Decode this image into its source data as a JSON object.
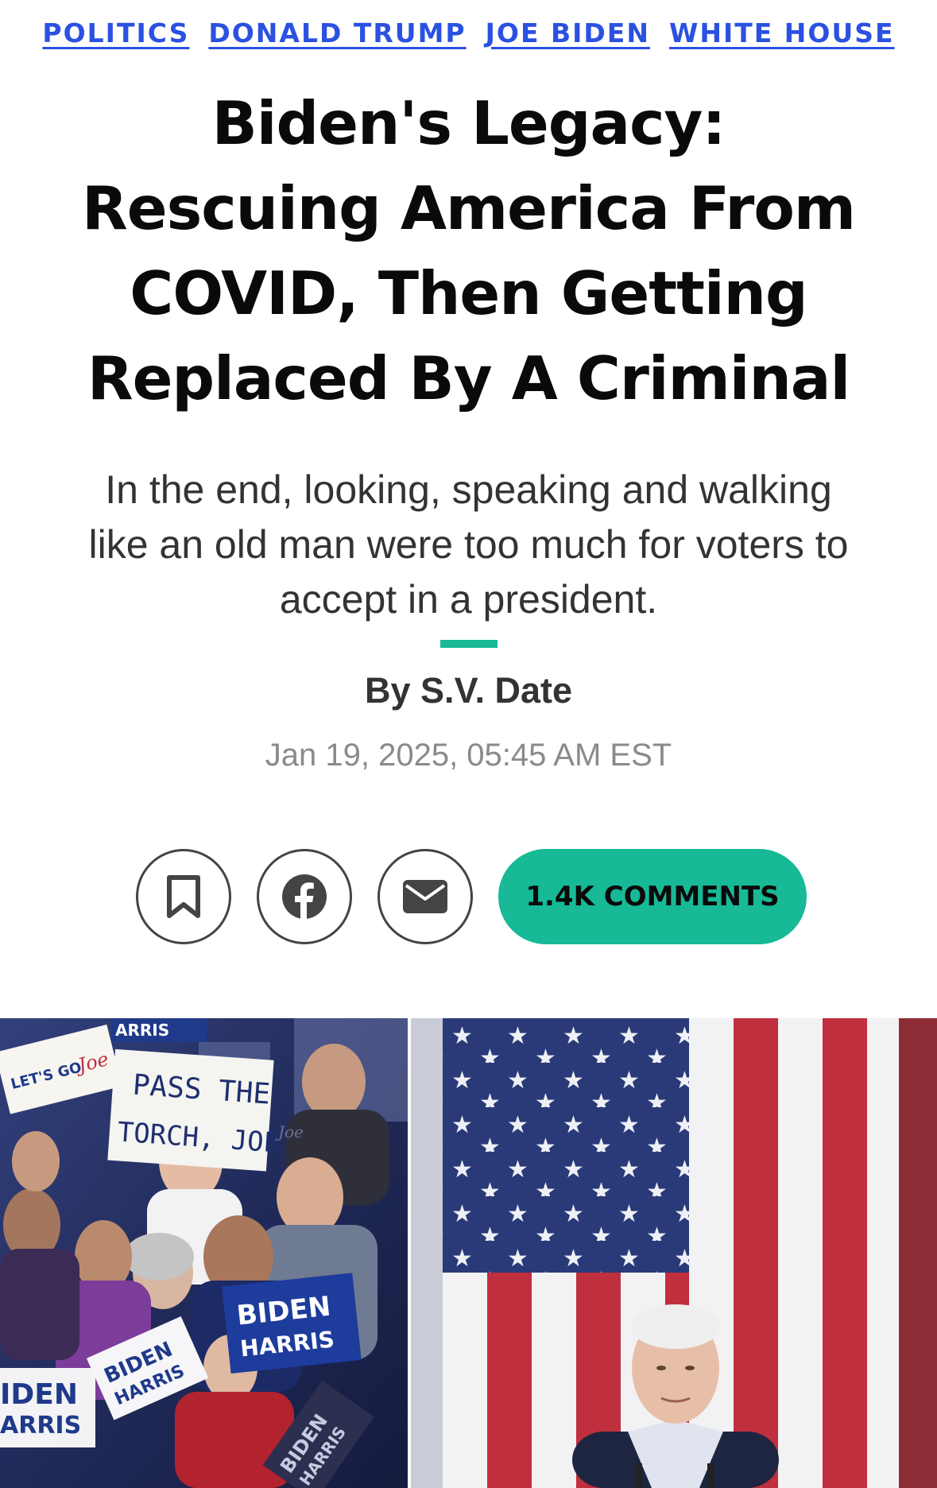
{
  "tags": [
    "POLITICS",
    "DONALD TRUMP",
    "JOE BIDEN",
    "WHITE HOUSE"
  ],
  "headline": "Biden's Legacy: Rescuing America From COVID, Then Getting Replaced By A Criminal",
  "dek": "In the end, looking, speaking and walking like an old man were too much for voters to accept in a president.",
  "byline": {
    "prefix": "By",
    "author": "S.V. Date"
  },
  "timestamp": "Jan 19, 2025, 05:45 AM EST",
  "actions": {
    "bookmark_icon": "bookmark-icon",
    "facebook_icon": "facebook-icon",
    "email_icon": "email-icon",
    "comments_label": "1.4K COMMENTS"
  },
  "photo": {
    "signs": {
      "lets_go": "LET'S GO",
      "lets_go_script": "Joe",
      "torch_line1": "PASS THE",
      "torch_line2": "TORCH, JOE",
      "arris": "ARRIS",
      "joe_small": "Joe",
      "biden_blue_top": "BIDEN",
      "biden_blue_bottom": "HARRIS",
      "biden_left_top": "IDEN",
      "biden_left_bottom": "ARRIS",
      "biden_tilt_top": "BIDEN",
      "biden_tilt_bottom": "HARRIS",
      "biden_dark_top": "BIDEN",
      "biden_dark_bottom": "HARRIS"
    }
  },
  "colors": {
    "tag_link": "#2b51e1",
    "accent_teal": "#17b996",
    "flag_red": "#bf2f3d",
    "flag_blue": "#2a3a78"
  }
}
